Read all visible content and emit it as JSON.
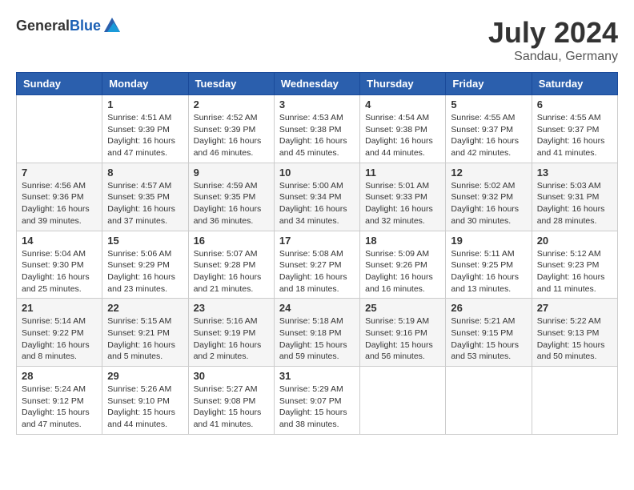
{
  "logo": {
    "text_general": "General",
    "text_blue": "Blue"
  },
  "header": {
    "month_year": "July 2024",
    "location": "Sandau, Germany"
  },
  "days_of_week": [
    "Sunday",
    "Monday",
    "Tuesday",
    "Wednesday",
    "Thursday",
    "Friday",
    "Saturday"
  ],
  "weeks": [
    [
      {
        "day": "",
        "info": ""
      },
      {
        "day": "1",
        "info": "Sunrise: 4:51 AM\nSunset: 9:39 PM\nDaylight: 16 hours\nand 47 minutes."
      },
      {
        "day": "2",
        "info": "Sunrise: 4:52 AM\nSunset: 9:39 PM\nDaylight: 16 hours\nand 46 minutes."
      },
      {
        "day": "3",
        "info": "Sunrise: 4:53 AM\nSunset: 9:38 PM\nDaylight: 16 hours\nand 45 minutes."
      },
      {
        "day": "4",
        "info": "Sunrise: 4:54 AM\nSunset: 9:38 PM\nDaylight: 16 hours\nand 44 minutes."
      },
      {
        "day": "5",
        "info": "Sunrise: 4:55 AM\nSunset: 9:37 PM\nDaylight: 16 hours\nand 42 minutes."
      },
      {
        "day": "6",
        "info": "Sunrise: 4:55 AM\nSunset: 9:37 PM\nDaylight: 16 hours\nand 41 minutes."
      }
    ],
    [
      {
        "day": "7",
        "info": "Sunrise: 4:56 AM\nSunset: 9:36 PM\nDaylight: 16 hours\nand 39 minutes."
      },
      {
        "day": "8",
        "info": "Sunrise: 4:57 AM\nSunset: 9:35 PM\nDaylight: 16 hours\nand 37 minutes."
      },
      {
        "day": "9",
        "info": "Sunrise: 4:59 AM\nSunset: 9:35 PM\nDaylight: 16 hours\nand 36 minutes."
      },
      {
        "day": "10",
        "info": "Sunrise: 5:00 AM\nSunset: 9:34 PM\nDaylight: 16 hours\nand 34 minutes."
      },
      {
        "day": "11",
        "info": "Sunrise: 5:01 AM\nSunset: 9:33 PM\nDaylight: 16 hours\nand 32 minutes."
      },
      {
        "day": "12",
        "info": "Sunrise: 5:02 AM\nSunset: 9:32 PM\nDaylight: 16 hours\nand 30 minutes."
      },
      {
        "day": "13",
        "info": "Sunrise: 5:03 AM\nSunset: 9:31 PM\nDaylight: 16 hours\nand 28 minutes."
      }
    ],
    [
      {
        "day": "14",
        "info": "Sunrise: 5:04 AM\nSunset: 9:30 PM\nDaylight: 16 hours\nand 25 minutes."
      },
      {
        "day": "15",
        "info": "Sunrise: 5:06 AM\nSunset: 9:29 PM\nDaylight: 16 hours\nand 23 minutes."
      },
      {
        "day": "16",
        "info": "Sunrise: 5:07 AM\nSunset: 9:28 PM\nDaylight: 16 hours\nand 21 minutes."
      },
      {
        "day": "17",
        "info": "Sunrise: 5:08 AM\nSunset: 9:27 PM\nDaylight: 16 hours\nand 18 minutes."
      },
      {
        "day": "18",
        "info": "Sunrise: 5:09 AM\nSunset: 9:26 PM\nDaylight: 16 hours\nand 16 minutes."
      },
      {
        "day": "19",
        "info": "Sunrise: 5:11 AM\nSunset: 9:25 PM\nDaylight: 16 hours\nand 13 minutes."
      },
      {
        "day": "20",
        "info": "Sunrise: 5:12 AM\nSunset: 9:23 PM\nDaylight: 16 hours\nand 11 minutes."
      }
    ],
    [
      {
        "day": "21",
        "info": "Sunrise: 5:14 AM\nSunset: 9:22 PM\nDaylight: 16 hours\nand 8 minutes."
      },
      {
        "day": "22",
        "info": "Sunrise: 5:15 AM\nSunset: 9:21 PM\nDaylight: 16 hours\nand 5 minutes."
      },
      {
        "day": "23",
        "info": "Sunrise: 5:16 AM\nSunset: 9:19 PM\nDaylight: 16 hours\nand 2 minutes."
      },
      {
        "day": "24",
        "info": "Sunrise: 5:18 AM\nSunset: 9:18 PM\nDaylight: 15 hours\nand 59 minutes."
      },
      {
        "day": "25",
        "info": "Sunrise: 5:19 AM\nSunset: 9:16 PM\nDaylight: 15 hours\nand 56 minutes."
      },
      {
        "day": "26",
        "info": "Sunrise: 5:21 AM\nSunset: 9:15 PM\nDaylight: 15 hours\nand 53 minutes."
      },
      {
        "day": "27",
        "info": "Sunrise: 5:22 AM\nSunset: 9:13 PM\nDaylight: 15 hours\nand 50 minutes."
      }
    ],
    [
      {
        "day": "28",
        "info": "Sunrise: 5:24 AM\nSunset: 9:12 PM\nDaylight: 15 hours\nand 47 minutes."
      },
      {
        "day": "29",
        "info": "Sunrise: 5:26 AM\nSunset: 9:10 PM\nDaylight: 15 hours\nand 44 minutes."
      },
      {
        "day": "30",
        "info": "Sunrise: 5:27 AM\nSunset: 9:08 PM\nDaylight: 15 hours\nand 41 minutes."
      },
      {
        "day": "31",
        "info": "Sunrise: 5:29 AM\nSunset: 9:07 PM\nDaylight: 15 hours\nand 38 minutes."
      },
      {
        "day": "",
        "info": ""
      },
      {
        "day": "",
        "info": ""
      },
      {
        "day": "",
        "info": ""
      }
    ]
  ]
}
